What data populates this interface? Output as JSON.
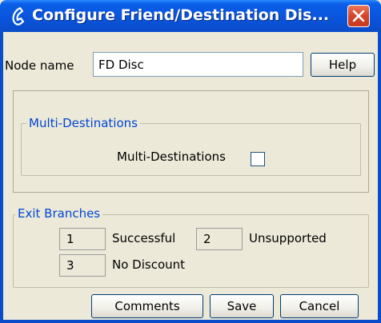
{
  "window": {
    "title": "Configure Friend/Destination Dis...",
    "colors": {
      "titlebar": "#0a54dc",
      "legend": "#0046d5",
      "close": "#d5452a"
    }
  },
  "node": {
    "label": "Node name",
    "value": "FD Disc",
    "help_label": "Help"
  },
  "multi_destinations": {
    "group_label": "Multi-Destinations",
    "checkbox_label": "Multi-Destinations",
    "checked": false
  },
  "exit_branches": {
    "group_label": "Exit Branches",
    "items": [
      {
        "number": "1",
        "label": "Successful"
      },
      {
        "number": "2",
        "label": "Unsupported"
      },
      {
        "number": "3",
        "label": "No Discount"
      }
    ]
  },
  "buttons": {
    "comments": "Comments",
    "save": "Save",
    "cancel": "Cancel"
  }
}
